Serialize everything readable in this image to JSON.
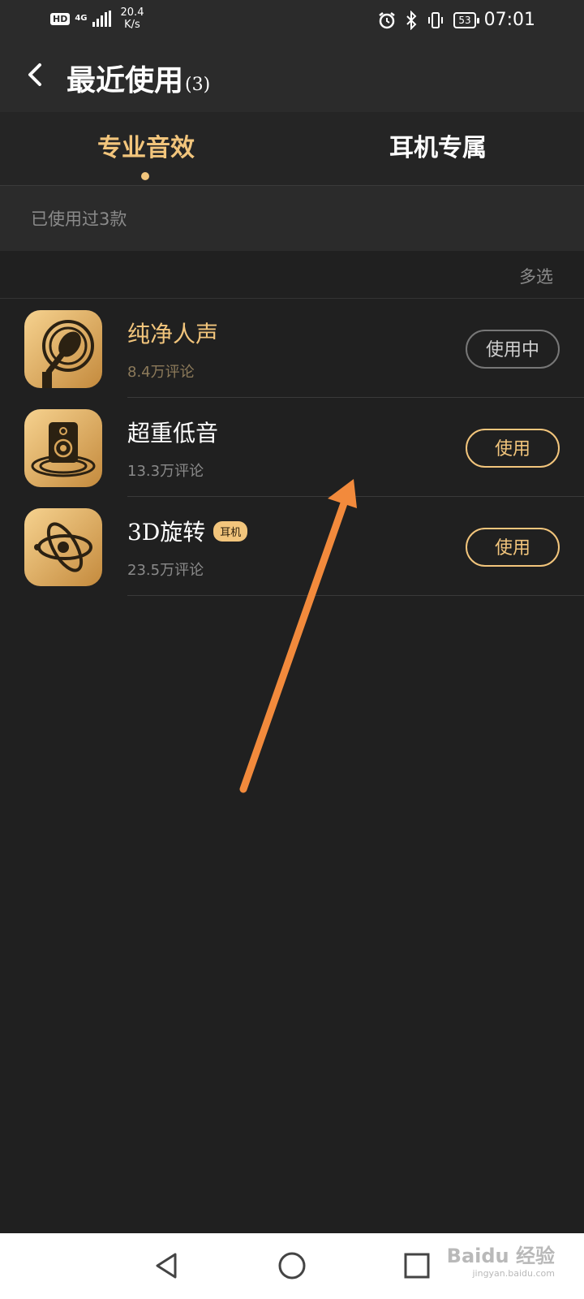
{
  "status_bar": {
    "hd": "HD",
    "network": "4G",
    "speed_value": "20.4",
    "speed_unit": "K/s",
    "battery": "53",
    "time": "07:01"
  },
  "header": {
    "title": "最近使用",
    "count": "(3)"
  },
  "tabs": [
    {
      "label": "专业音效",
      "active": true
    },
    {
      "label": "耳机专属",
      "active": false
    }
  ],
  "used_summary": "已使用过3款",
  "multi_select": "多选",
  "effects": [
    {
      "name": "纯净人声",
      "comments": "8.4万评论",
      "button": "使用中",
      "in_use": true,
      "icon": "microphone-icon"
    },
    {
      "name": "超重低音",
      "comments": "13.3万评论",
      "button": "使用",
      "in_use": false,
      "icon": "speaker-icon"
    },
    {
      "name": "3D旋转",
      "tag": "耳机",
      "comments": "23.5万评论",
      "button": "使用",
      "in_use": false,
      "icon": "orbit-icon"
    }
  ],
  "watermark": {
    "text": "Baidu 经验",
    "sub": "jingyan.baidu.com"
  },
  "colors": {
    "accent": "#f2c57c",
    "background": "#202020",
    "annotation_arrow": "#f28a3c"
  }
}
